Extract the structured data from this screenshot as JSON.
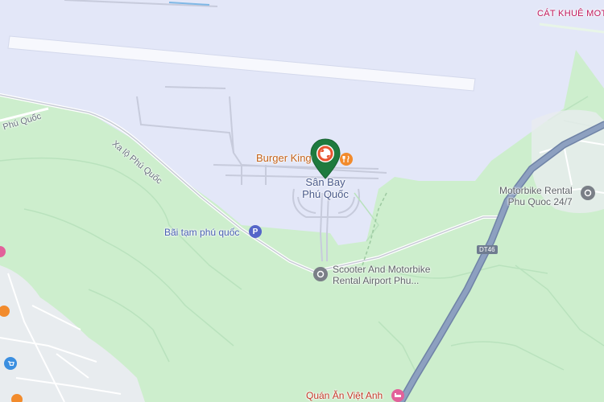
{
  "map": {
    "title_area": "Sân Bay Phú Quốc",
    "airport": {
      "line1": "Sân Bay",
      "line2": "Phú Quốc"
    },
    "pois": {
      "burger_king": "Burger King",
      "parking": "Bãi tạm phú quốc",
      "scooter_line1": "Scooter And Motorbike",
      "scooter_line2": "Rental Airport Phu...",
      "motorbike_line1": "Motorbike Rental",
      "motorbike_line2": "Phu Quoc 24/7",
      "cat_khue": "CÁT KHUÊ MOTO",
      "quan_an": "Quán Ăn Việt Anh"
    },
    "roads": {
      "xa_lo": "Xa lộ Phú Quốc",
      "top_left": "Phú Quốc",
      "shield": "DT46"
    },
    "icons": {
      "selected_pin": "map-pin-icon",
      "parking": "parking-icon",
      "restaurant": "fork-knife-icon",
      "location": "location-dot-icon",
      "hotel": "hotel-icon"
    },
    "colors": {
      "land": "#cdeecd",
      "airport_area": "#e3e7f8",
      "highway": "#8196b8",
      "pin": "#1e7a3e"
    }
  }
}
